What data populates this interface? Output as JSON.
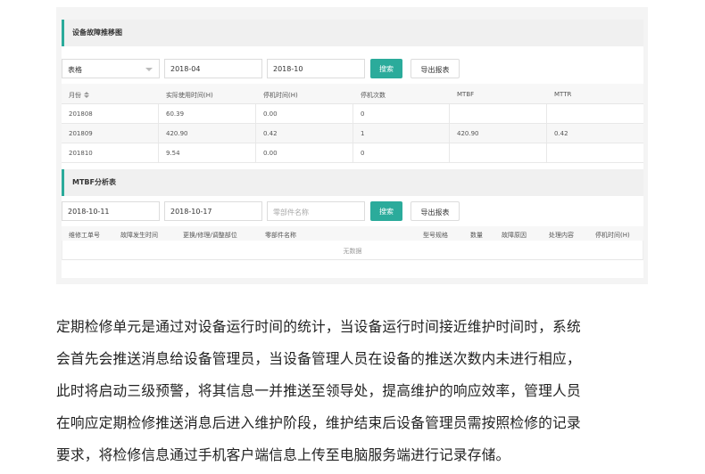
{
  "section1": {
    "title": "设备故障推移图",
    "view_select": "表格",
    "start_month": "2018-04",
    "end_month": "2018-10",
    "search_label": "搜索",
    "export_label": "导出报表",
    "columns": [
      "月份",
      "实际使用时间(H)",
      "停机时间(H)",
      "停机次数",
      "MTBF",
      "MTTR"
    ],
    "rows": [
      [
        "201808",
        "60.39",
        "0.00",
        "0",
        "",
        ""
      ],
      [
        "201809",
        "420.90",
        "0.42",
        "1",
        "420.90",
        "0.42"
      ],
      [
        "201810",
        "9.54",
        "0.00",
        "0",
        "",
        ""
      ]
    ]
  },
  "section2": {
    "title": "MTBF分析表",
    "start_date": "2018-10-11",
    "end_date": "2018-10-17",
    "part_placeholder": "零部件名称",
    "search_label": "搜索",
    "export_label": "导出报表",
    "columns": [
      "维修工单号",
      "故障发生时间",
      "更换/修理/调整部位",
      "零部件名称",
      "型号规格",
      "数量",
      "故障原因",
      "处理内容",
      "停机时间(H)"
    ],
    "empty_text": "无数据"
  },
  "description": {
    "lines": [
      "定期检修单元是通过对设备运行时间的统计，当设备运行时间接近维护时间时，系统",
      "会首先会推送消息给设备管理员，当设备管理人员在设备的推送次数内未进行相应，",
      "此时将启动三级预警，将其信息一并推送至领导处，提高维护的响应效率，管理人员",
      "在响应定期检修推送消息后进入维护阶段，维护结束后设备管理员需按照检修的记录",
      "要求，将检修信息通过手机客户端信息上传至电脑服务端进行记录存储。"
    ]
  }
}
